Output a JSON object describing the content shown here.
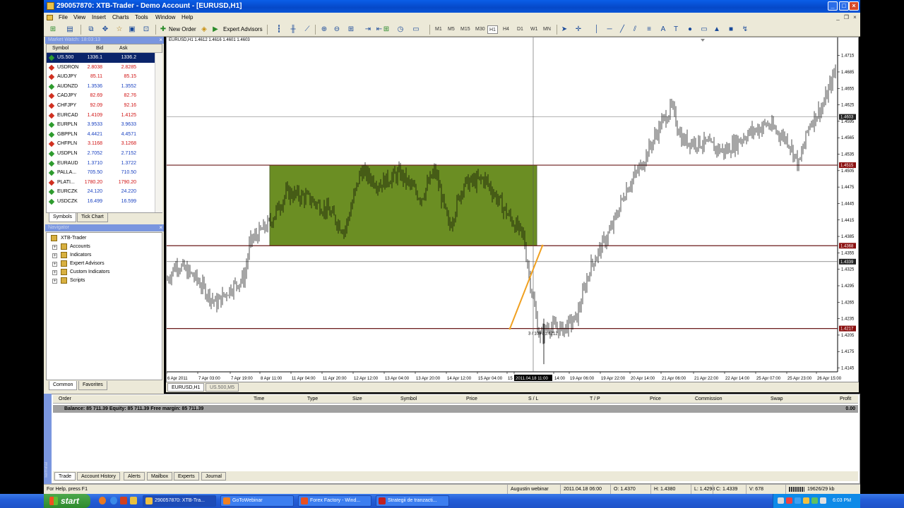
{
  "window": {
    "title": "290057870: XTB-Trader - Demo Account - [EURUSD,H1]",
    "btn_min": "_",
    "btn_max": "□",
    "btn_close": "×"
  },
  "menu": [
    "File",
    "View",
    "Insert",
    "Charts",
    "Tools",
    "Window",
    "Help"
  ],
  "toolbar": {
    "new_order": "New Order",
    "expert_advisors": "Expert Advisors",
    "timeframes": [
      "M1",
      "M5",
      "M15",
      "M30",
      "H1",
      "H4",
      "D1",
      "W1",
      "MN"
    ],
    "active_timeframe": "H1"
  },
  "market_watch": {
    "title": "Market Watch: 18:03:13",
    "columns": [
      "Symbol",
      "Bid",
      "Ask"
    ],
    "rows": [
      {
        "symbol": "US.500",
        "bid": "1336.1",
        "ask": "1336.2",
        "dir": "up",
        "selected": true
      },
      {
        "symbol": "USDRON",
        "bid": "2.8038",
        "ask": "2.8285",
        "dir": "dn"
      },
      {
        "symbol": "AUDJPY",
        "bid": "85.11",
        "ask": "85.15",
        "dir": "dn"
      },
      {
        "symbol": "AUDNZD",
        "bid": "1.3536",
        "ask": "1.3552",
        "dir": "up"
      },
      {
        "symbol": "CADJPY",
        "bid": "82.69",
        "ask": "82.76",
        "dir": "dn"
      },
      {
        "symbol": "CHFJPY",
        "bid": "92.09",
        "ask": "92.16",
        "dir": "dn"
      },
      {
        "symbol": "EURCAD",
        "bid": "1.4109",
        "ask": "1.4125",
        "dir": "dn"
      },
      {
        "symbol": "EURPLN",
        "bid": "3.9533",
        "ask": "3.9633",
        "dir": "up"
      },
      {
        "symbol": "GBPPLN",
        "bid": "4.4421",
        "ask": "4.4571",
        "dir": "up"
      },
      {
        "symbol": "CHFPLN",
        "bid": "3.1168",
        "ask": "3.1268",
        "dir": "dn"
      },
      {
        "symbol": "USDPLN",
        "bid": "2.7052",
        "ask": "2.7152",
        "dir": "up"
      },
      {
        "symbol": "EURAUD",
        "bid": "1.3710",
        "ask": "1.3722",
        "dir": "up"
      },
      {
        "symbol": "PALLA...",
        "bid": "705.50",
        "ask": "710.50",
        "dir": "up"
      },
      {
        "symbol": "PLATI...",
        "bid": "1780.20",
        "ask": "1790.20",
        "dir": "dn"
      },
      {
        "symbol": "EURCZK",
        "bid": "24.120",
        "ask": "24.220",
        "dir": "up"
      },
      {
        "symbol": "USDCZK",
        "bid": "16.499",
        "ask": "16.599",
        "dir": "up"
      }
    ],
    "tabs": [
      "Symbols",
      "Tick Chart"
    ]
  },
  "navigator": {
    "title": "Navigator",
    "root": "XTB-Trader",
    "items": [
      "Accounts",
      "Indicators",
      "Expert Advisors",
      "Custom Indicators",
      "Scripts"
    ],
    "tabs": [
      "Common",
      "Favorites"
    ]
  },
  "chart": {
    "info": "EURUSD,H1  1.4612 1.4616 1.4601 1.4603",
    "tabs": [
      "EURUSD,H1",
      "US.500,M5"
    ],
    "crosshair_label": "3 / 109 / 1.4212",
    "time_highlight": "2011.04.18 11:00"
  },
  "chart_data": {
    "type": "candlestick",
    "symbol": "EURUSD",
    "timeframe": "H1",
    "y_ticks": [
      "1.4715",
      "1.4685",
      "1.4655",
      "1.4625",
      "1.4595",
      "1.4565",
      "1.4535",
      "1.4505",
      "1.4475",
      "1.4445",
      "1.4415",
      "1.4385",
      "1.4355",
      "1.4325",
      "1.4295",
      "1.4265",
      "1.4235",
      "1.4205",
      "1.4175",
      "1.4145"
    ],
    "x_ticks": [
      "6 Apr 2011",
      "7 Apr 03:00",
      "7 Apr 19:00",
      "8 Apr 11:00",
      "11 Apr 04:00",
      "11 Apr 20:00",
      "12 Apr 12:00",
      "13 Apr 04:00",
      "13 Apr 20:00",
      "14 Apr 12:00",
      "15 Apr 04:00",
      "15",
      "2011.04.18 11:00",
      "14:00",
      "19 Apr 06:00",
      "19 Apr 22:00",
      "20 Apr 14:00",
      "21 Apr 06:00",
      "21 Apr 22:00",
      "22 Apr 14:00",
      "25 Apr 07:00",
      "25 Apr 23:00",
      "26 Apr 15:00"
    ],
    "price_labels": [
      {
        "value": "1.4603",
        "style": "dark"
      },
      {
        "value": "1.4515",
        "style": "red"
      },
      {
        "value": "1.4368",
        "style": "red"
      },
      {
        "value": "1.4339",
        "style": "dark"
      },
      {
        "value": "1.4217",
        "style": "red"
      }
    ],
    "horizontal_lines": [
      1.4603,
      1.4515,
      1.4368,
      1.4339,
      1.4217
    ],
    "rectangle": {
      "price_top": 1.4515,
      "price_bottom": 1.4368,
      "color": "#6b8e23"
    },
    "trendline": {
      "from": 1.4217,
      "to": 1.4368,
      "color": "#f0a020"
    },
    "visible_price_range": [
      1.4138,
      1.4748
    ]
  },
  "terminal": {
    "columns": [
      "Order",
      "Time",
      "Type",
      "Size",
      "Symbol",
      "Price",
      "S / L",
      "T / P",
      "Price",
      "Commission",
      "Swap",
      "Profit"
    ],
    "balance_line": "Balance: 85 711.39  Equity: 85 711.39  Free margin: 85 711.39",
    "profit": "0.00",
    "tabs": [
      "Trade",
      "Account History",
      "Alerts",
      "Mailbox",
      "Experts",
      "Journal"
    ],
    "side_label": "Terminal"
  },
  "status": {
    "help": "For Help, press F1",
    "profile": "Augustin webinar",
    "datetime": "2011.04.18 06:00",
    "open": "O: 1.4370",
    "high": "H: 1.4380",
    "low": "L: 1.4298",
    "close": "C: 1.4339",
    "volume": "V: 678",
    "traffic": "19626/29 kb"
  },
  "taskbar": {
    "start": "start",
    "buttons": [
      "290057870: XTB-Tra...",
      "GoToWebinar",
      "Forex Factory - Wind...",
      "Strategii de tranzacti..."
    ],
    "clock": "6:03 PM"
  }
}
